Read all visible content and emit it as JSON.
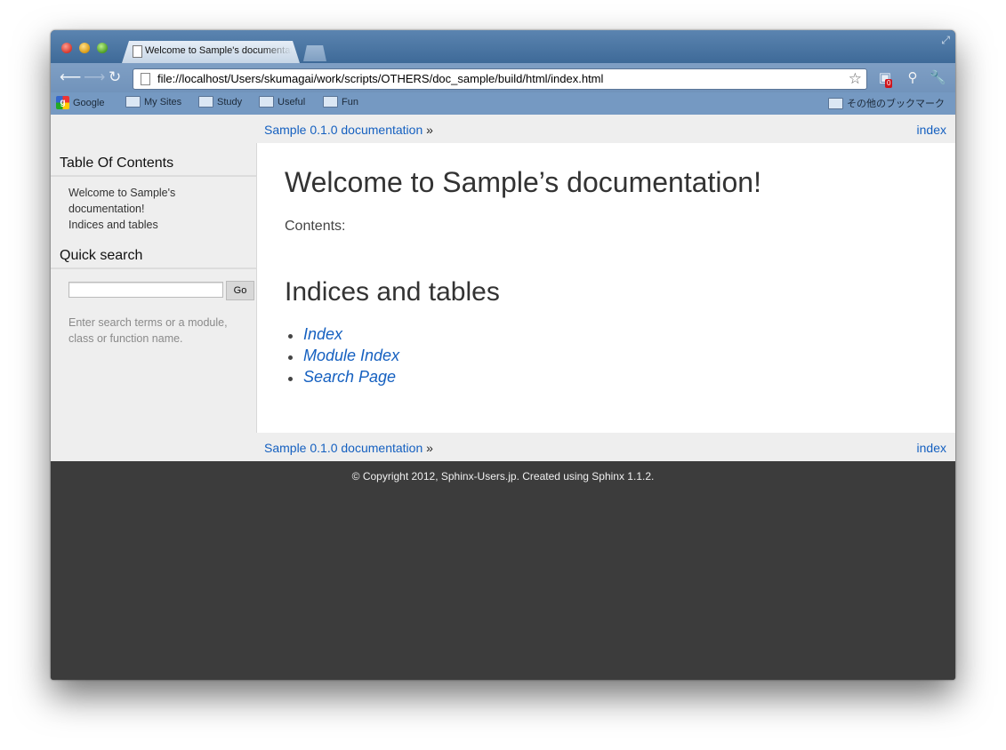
{
  "browser": {
    "tab_title": "Welcome to Sample's documentation!",
    "url": "file://localhost/Users/skumagai/work/scripts/OTHERS/doc_sample/build/html/index.html",
    "extension_badge": "0",
    "nav_icons": [
      "back-arrow-icon",
      "forward-arrow-icon",
      "reload-icon"
    ]
  },
  "bookmarks": {
    "items": [
      "Google",
      "My Sites",
      "Study",
      "Useful",
      "Fun"
    ],
    "other": "その他のブックマーク"
  },
  "relbar": {
    "home_link": "Sample 0.1.0 documentation",
    "separator": "»",
    "index_link": "index"
  },
  "sidebar": {
    "toc_title": "Table Of Contents",
    "toc_items": [
      "Welcome to Sample's documentation!",
      "Indices and tables"
    ],
    "search_title": "Quick search",
    "search_value": "",
    "go_label": "Go",
    "search_hint": "Enter search terms or a module, class or function name."
  },
  "main": {
    "title": "Welcome to Sample’s documentation!",
    "contents_label": "Contents:",
    "section_title": "Indices and tables",
    "links": [
      "Index",
      "Module Index",
      "Search Page"
    ]
  },
  "footer": {
    "text": "© Copyright 2012, Sphinx-Users.jp. Created using Sphinx 1.1.2."
  },
  "colors": {
    "link": "#1560c0",
    "footer_bg": "#3c3c3c",
    "relbar_bg": "#eeeeee"
  }
}
